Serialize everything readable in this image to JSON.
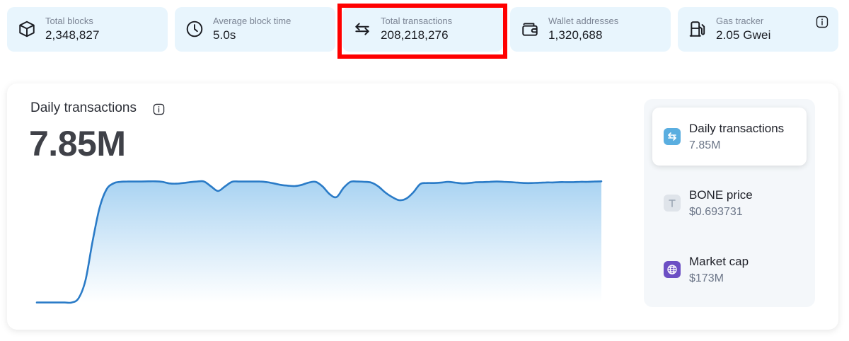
{
  "stats": [
    {
      "label": "Total blocks",
      "value": "2,348,827",
      "icon": "cube-icon"
    },
    {
      "label": "Average block time",
      "value": "5.0s",
      "icon": "clock-icon"
    },
    {
      "label": "Total transactions",
      "value": "208,218,276",
      "icon": "swap-arrows-icon"
    },
    {
      "label": "Wallet addresses",
      "value": "1,320,688",
      "icon": "wallet-icon"
    },
    {
      "label": "Gas tracker",
      "value": "2.05 Gwei",
      "icon": "gas-pump-icon"
    }
  ],
  "chart": {
    "title": "Daily transactions",
    "value": "7.85M"
  },
  "panel": [
    {
      "title": "Daily transactions",
      "value": "7.85M",
      "icon": "swap-arrows-icon",
      "active": true
    },
    {
      "title": "BONE price",
      "value": "$0.693731",
      "icon": "token-t-icon",
      "active": false
    },
    {
      "title": "Market cap",
      "value": "$173M",
      "icon": "globe-icon",
      "active": false
    }
  ],
  "colors": {
    "stat_bg": "#e8f5fd",
    "line": "#2a7bc7",
    "highlight": "#ff0000",
    "panel_bg": "#f4f7fa"
  },
  "chart_data": {
    "type": "area",
    "title": "Daily transactions",
    "x": [
      0,
      1,
      2,
      3,
      4,
      5,
      6,
      7,
      8,
      9,
      10,
      11,
      12,
      13,
      14,
      15,
      16,
      17,
      18,
      19,
      20,
      21,
      22,
      23,
      24,
      25,
      26,
      27,
      28,
      29,
      30,
      31,
      32,
      33,
      34,
      35,
      36,
      37,
      38,
      39,
      40,
      41,
      42,
      43,
      44,
      45,
      46,
      47,
      48,
      49,
      50,
      51,
      52,
      53,
      54,
      55,
      56,
      57,
      58,
      59,
      60,
      61,
      62,
      63,
      64,
      65,
      66,
      67,
      68,
      69,
      70,
      71,
      72,
      73,
      74,
      75,
      76,
      77,
      78,
      79,
      80,
      81
    ],
    "values": [
      0.02,
      0.02,
      0.02,
      0.02,
      0.02,
      0.02,
      0.3,
      1.5,
      4.0,
      6.2,
      7.4,
      7.8,
      7.9,
      7.92,
      7.92,
      7.92,
      7.93,
      7.93,
      7.9,
      7.8,
      7.78,
      7.82,
      7.88,
      7.92,
      7.92,
      7.6,
      7.3,
      7.6,
      7.9,
      7.92,
      7.92,
      7.92,
      7.92,
      7.88,
      7.8,
      7.7,
      7.65,
      7.62,
      7.7,
      7.85,
      7.9,
      7.6,
      7.1,
      6.9,
      7.5,
      7.9,
      7.92,
      7.9,
      7.85,
      7.6,
      7.2,
      6.9,
      6.7,
      6.8,
      7.2,
      7.75,
      7.82,
      7.82,
      7.85,
      7.9,
      7.85,
      7.8,
      7.82,
      7.87,
      7.88,
      7.9,
      7.92,
      7.9,
      7.88,
      7.85,
      7.82,
      7.82,
      7.84,
      7.86,
      7.86,
      7.88,
      7.88,
      7.88,
      7.9,
      7.9,
      7.92,
      7.93
    ],
    "ylim": [
      0,
      8.5
    ],
    "grid": false,
    "legend": "none"
  }
}
